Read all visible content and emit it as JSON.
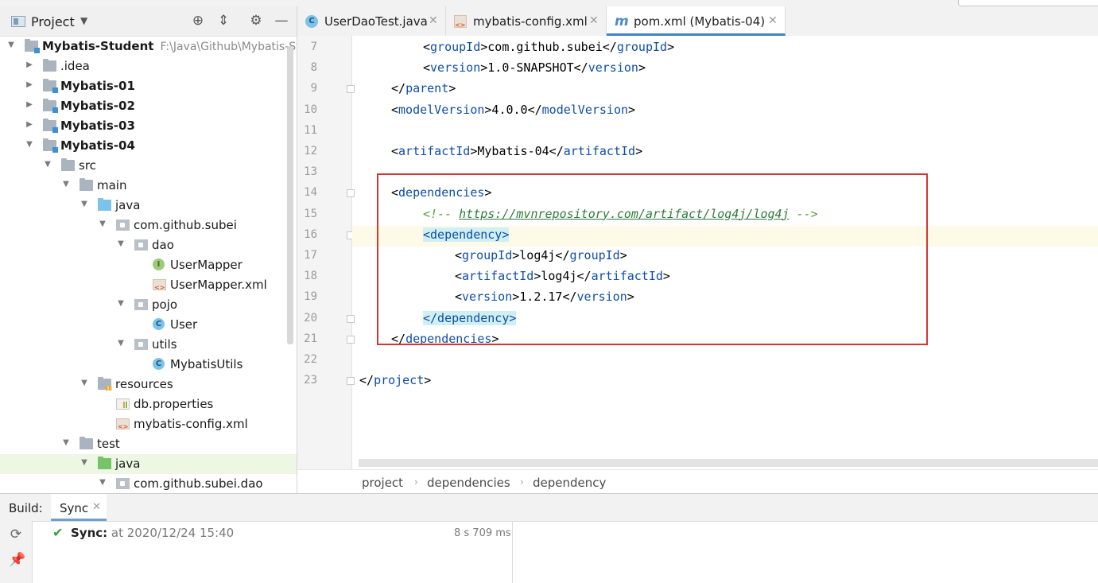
{
  "project_panel": {
    "title": "Project",
    "tree": [
      {
        "label": "Mybatis-Student",
        "hint": "F:\\Java\\Github\\Mybatis-St",
        "bold": true,
        "icon": "module-folder-icon",
        "depth": 0,
        "expanded": true
      },
      {
        "label": ".idea",
        "bold": false,
        "icon": "folder-icon",
        "depth": 1,
        "expanded": false
      },
      {
        "label": "Mybatis-01",
        "bold": true,
        "icon": "module-folder-icon",
        "depth": 1,
        "expanded": false
      },
      {
        "label": "Mybatis-02",
        "bold": true,
        "icon": "module-folder-icon",
        "depth": 1,
        "expanded": false
      },
      {
        "label": "Mybatis-03",
        "bold": true,
        "icon": "module-folder-icon",
        "depth": 1,
        "expanded": false
      },
      {
        "label": "Mybatis-04",
        "bold": true,
        "icon": "module-folder-icon",
        "depth": 1,
        "expanded": true
      },
      {
        "label": "src",
        "bold": false,
        "icon": "folder-icon",
        "depth": 2,
        "expanded": true
      },
      {
        "label": "main",
        "bold": false,
        "icon": "folder-icon",
        "depth": 3,
        "expanded": true
      },
      {
        "label": "java",
        "bold": false,
        "icon": "source-folder-icon",
        "depth": 4,
        "expanded": true
      },
      {
        "label": "com.github.subei",
        "bold": false,
        "icon": "package-icon",
        "depth": 5,
        "expanded": true
      },
      {
        "label": "dao",
        "bold": false,
        "icon": "package-icon",
        "depth": 6,
        "expanded": true
      },
      {
        "label": "UserMapper",
        "bold": false,
        "icon": "interface-icon",
        "depth": 7,
        "expanded": null
      },
      {
        "label": "UserMapper.xml",
        "bold": false,
        "icon": "xml-file-icon",
        "depth": 7,
        "expanded": null
      },
      {
        "label": "pojo",
        "bold": false,
        "icon": "package-icon",
        "depth": 6,
        "expanded": true
      },
      {
        "label": "User",
        "bold": false,
        "icon": "class-icon",
        "depth": 7,
        "expanded": null
      },
      {
        "label": "utils",
        "bold": false,
        "icon": "package-icon",
        "depth": 6,
        "expanded": true
      },
      {
        "label": "MybatisUtils",
        "bold": false,
        "icon": "class-icon",
        "depth": 7,
        "expanded": null
      },
      {
        "label": "resources",
        "bold": false,
        "icon": "resources-folder-icon",
        "depth": 4,
        "expanded": true
      },
      {
        "label": "db.properties",
        "bold": false,
        "icon": "properties-file-icon",
        "depth": 5,
        "expanded": null
      },
      {
        "label": "mybatis-config.xml",
        "bold": false,
        "icon": "xml-file-icon",
        "depth": 5,
        "expanded": null
      },
      {
        "label": "test",
        "bold": false,
        "icon": "folder-icon",
        "depth": 3,
        "expanded": true
      },
      {
        "label": "java",
        "bold": false,
        "icon": "test-folder-icon",
        "depth": 4,
        "expanded": true,
        "selected": true
      },
      {
        "label": "com.github.subei.dao",
        "bold": false,
        "icon": "package-icon",
        "depth": 5,
        "expanded": true
      }
    ]
  },
  "tabs": [
    {
      "label": "UserDaoTest.java",
      "icon": "java-class-icon",
      "active": false
    },
    {
      "label": "mybatis-config.xml",
      "icon": "xml-file-icon",
      "active": false
    },
    {
      "label": "pom.xml (Mybatis-04)",
      "icon": "maven-icon",
      "active": true
    }
  ],
  "editor": {
    "lines": [
      {
        "num": "7",
        "fold": false,
        "indent": 2,
        "tokens": [
          [
            "<",
            ""
          ],
          [
            "groupId",
            "t"
          ],
          [
            ">com.github.subei</",
            ""
          ],
          [
            "groupId",
            "t"
          ],
          [
            ">",
            ""
          ]
        ]
      },
      {
        "num": "8",
        "fold": false,
        "indent": 2,
        "tokens": [
          [
            "<",
            ""
          ],
          [
            "version",
            "t"
          ],
          [
            ">1.0-SNAPSHOT</",
            ""
          ],
          [
            "version",
            "t"
          ],
          [
            ">",
            ""
          ]
        ]
      },
      {
        "num": "9",
        "fold": true,
        "indent": 1,
        "tokens": [
          [
            "</",
            ""
          ],
          [
            "parent",
            "t"
          ],
          [
            ">",
            ""
          ]
        ]
      },
      {
        "num": "10",
        "fold": false,
        "indent": 1,
        "tokens": [
          [
            "<",
            ""
          ],
          [
            "modelVersion",
            "t"
          ],
          [
            ">4.0.0</",
            ""
          ],
          [
            "modelVersion",
            "t"
          ],
          [
            ">",
            ""
          ]
        ]
      },
      {
        "num": "11",
        "fold": false,
        "indent": 0,
        "tokens": []
      },
      {
        "num": "12",
        "fold": false,
        "indent": 1,
        "tokens": [
          [
            "<",
            ""
          ],
          [
            "artifactId",
            "t"
          ],
          [
            ">Mybatis-04</",
            ""
          ],
          [
            "artifactId",
            "t"
          ],
          [
            ">",
            ""
          ]
        ]
      },
      {
        "num": "13",
        "fold": false,
        "indent": 0,
        "tokens": []
      },
      {
        "num": "14",
        "fold": true,
        "indent": 1,
        "tokens": [
          [
            "<",
            ""
          ],
          [
            "dependencies",
            "t"
          ],
          [
            ">",
            ""
          ]
        ]
      },
      {
        "num": "15",
        "fold": false,
        "indent": 2,
        "tokens": [
          [
            "<!-- ",
            "cm"
          ],
          [
            "https://mvnrepository.com/artifact/log4j/log4j",
            "url"
          ],
          [
            " -->",
            "cm"
          ]
        ]
      },
      {
        "num": "16",
        "fold": true,
        "indent": 2,
        "current": true,
        "tokens": [
          [
            "<dependency>",
            "hl"
          ]
        ]
      },
      {
        "num": "17",
        "fold": false,
        "indent": 3,
        "tokens": [
          [
            "<",
            ""
          ],
          [
            "groupId",
            "t"
          ],
          [
            ">log4j</",
            ""
          ],
          [
            "groupId",
            "t"
          ],
          [
            ">",
            ""
          ]
        ]
      },
      {
        "num": "18",
        "fold": false,
        "indent": 3,
        "tokens": [
          [
            "<",
            ""
          ],
          [
            "artifactId",
            "t"
          ],
          [
            ">log4j</",
            ""
          ],
          [
            "artifactId",
            "t"
          ],
          [
            ">",
            ""
          ]
        ]
      },
      {
        "num": "19",
        "fold": false,
        "indent": 3,
        "tokens": [
          [
            "<",
            ""
          ],
          [
            "version",
            "t"
          ],
          [
            ">1.2.17</",
            ""
          ],
          [
            "version",
            "t"
          ],
          [
            ">",
            ""
          ]
        ]
      },
      {
        "num": "20",
        "fold": true,
        "indent": 2,
        "tokens": [
          [
            "</dependency>",
            "hl"
          ]
        ]
      },
      {
        "num": "21",
        "fold": true,
        "indent": 1,
        "tokens": [
          [
            "</",
            ""
          ],
          [
            "dependencies",
            "t"
          ],
          [
            ">",
            ""
          ]
        ]
      },
      {
        "num": "22",
        "fold": false,
        "indent": 0,
        "tokens": []
      },
      {
        "num": "23",
        "fold": true,
        "indent": 0,
        "tokens": [
          [
            "</",
            ""
          ],
          [
            "project",
            "t"
          ],
          [
            ">",
            ""
          ]
        ]
      }
    ]
  },
  "breadcrumb": [
    "project",
    "dependencies",
    "dependency"
  ],
  "build_panel": {
    "label": "Build:",
    "tab": "Sync",
    "status_bold": "Sync:",
    "status_text": " at 2020/12/24 15:40",
    "duration": "8 s 709 ms"
  },
  "colors": {
    "tag": "#0e4da8",
    "comment": "#5b9b3c",
    "highlight_box": "#d43535",
    "current_line": "#fdfbe8",
    "tag_match": "#cfeff2"
  }
}
